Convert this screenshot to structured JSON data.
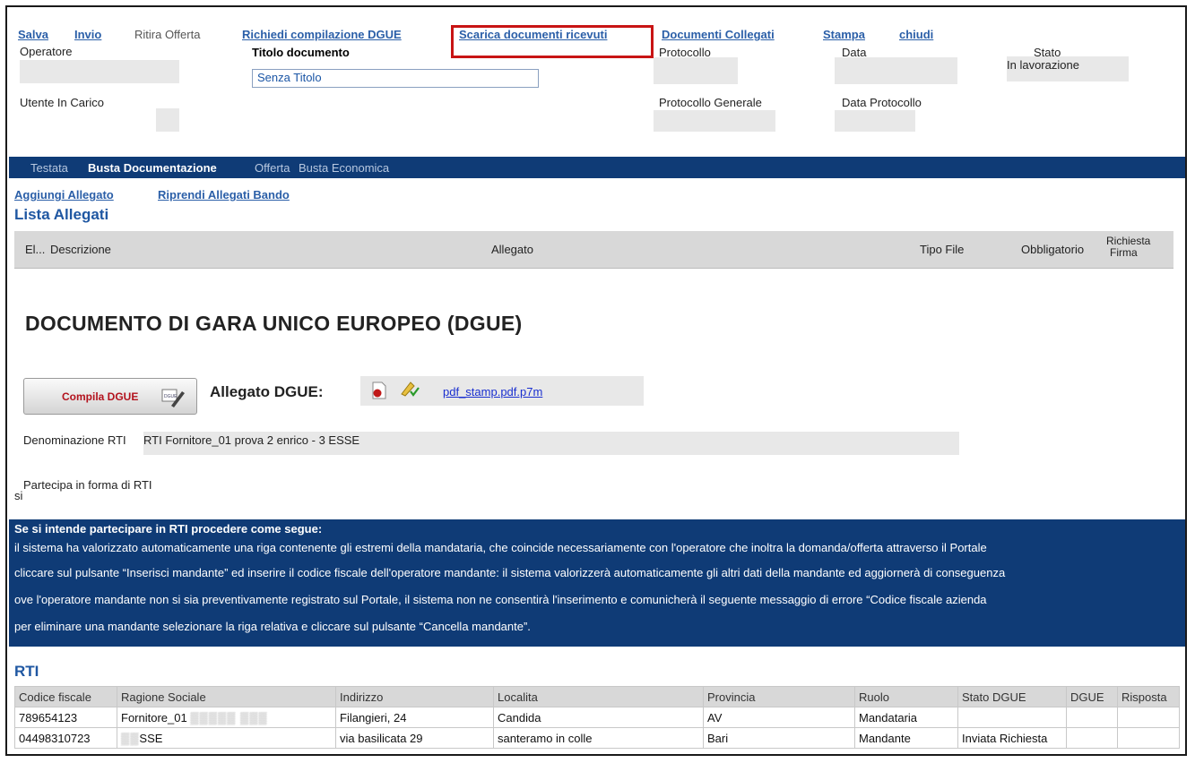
{
  "toolbar": {
    "salva": "Salva",
    "invio": "Invio",
    "ritira": "Ritira Offerta",
    "richiedi": "Richiedi compilazione DGUE",
    "scarica": "Scarica documenti ricevuti",
    "collegati": "Documenti Collegati",
    "stampa": "Stampa",
    "chiudi": "chiudi"
  },
  "header": {
    "operatore_label": "Operatore",
    "titolo_label": "Titolo documento",
    "titolo_value": "Senza Titolo",
    "protocollo_label": "Protocollo",
    "data_label": "Data",
    "stato_label": "Stato",
    "stato_value": "In lavorazione",
    "utente_label": "Utente In Carico",
    "protocollo_generale_label": "Protocollo Generale",
    "data_protocollo_label": "Data Protocollo"
  },
  "tabs": [
    "Testata",
    "Busta Documentazione",
    "Offerta",
    "Busta Economica"
  ],
  "actions": {
    "aggiungi": "Aggiungi Allegato",
    "riprendi": "Riprendi Allegati Bando"
  },
  "allegati": {
    "title": "Lista Allegati",
    "columns": [
      "El...",
      "Descrizione",
      "Allegato",
      "Tipo File",
      "Obbligatorio",
      "Richiesta",
      "Firma"
    ]
  },
  "dgue": {
    "title": "DOCUMENTO DI GARA UNICO EUROPEO (DGUE)",
    "button": "Compila DGUE",
    "allegato_label": "Allegato DGUE:",
    "file_link": "pdf_stamp.pdf.p7m",
    "denominazione_label": "Denominazione RTI",
    "denominazione_value": "RTI Fornitore_01 prova 2 enrico - 3 ESSE",
    "partecipa_label": "Partecipa in forma di RTI",
    "partecipa_value": "si"
  },
  "notice": {
    "heading": "Se si intende partecipare in RTI procedere come segue:",
    "lines": [
      "il sistema ha valorizzato automaticamente una riga contenente gli estremi della mandataria, che coincide necessariamente con l'operatore che inoltra la domanda/offerta attraverso il Portale",
      "cliccare sul pulsante “Inserisci mandante” ed inserire il codice fiscale dell'operatore mandante: il sistema valorizzerà automaticamente gli altri dati della mandante ed aggiornerà di conseguenza",
      "ove l'operatore mandante non si sia preventivamente registrato sul Portale, il sistema non ne consentirà l'inserimento e comunicherà il seguente messaggio di errore “Codice fiscale azienda",
      "per eliminare una mandante selezionare la riga relativa e cliccare sul pulsante “Cancella mandante”."
    ]
  },
  "rti": {
    "title": "RTI",
    "columns": [
      "Codice fiscale",
      "Ragione Sociale",
      "Indirizzo",
      "Localita",
      "Provincia",
      "Ruolo",
      "Stato DGUE",
      "DGUE",
      "Risposta"
    ],
    "rows": [
      [
        "789654123",
        "Fornitore_01",
        "Filangieri, 24",
        "Candida",
        "AV",
        "Mandataria",
        "",
        "",
        ""
      ],
      [
        "04498310723",
        "SSE",
        "via basilicata 29",
        "santeramo in colle",
        "Bari",
        "Mandante",
        "Inviata Richiesta",
        "",
        ""
      ]
    ]
  }
}
